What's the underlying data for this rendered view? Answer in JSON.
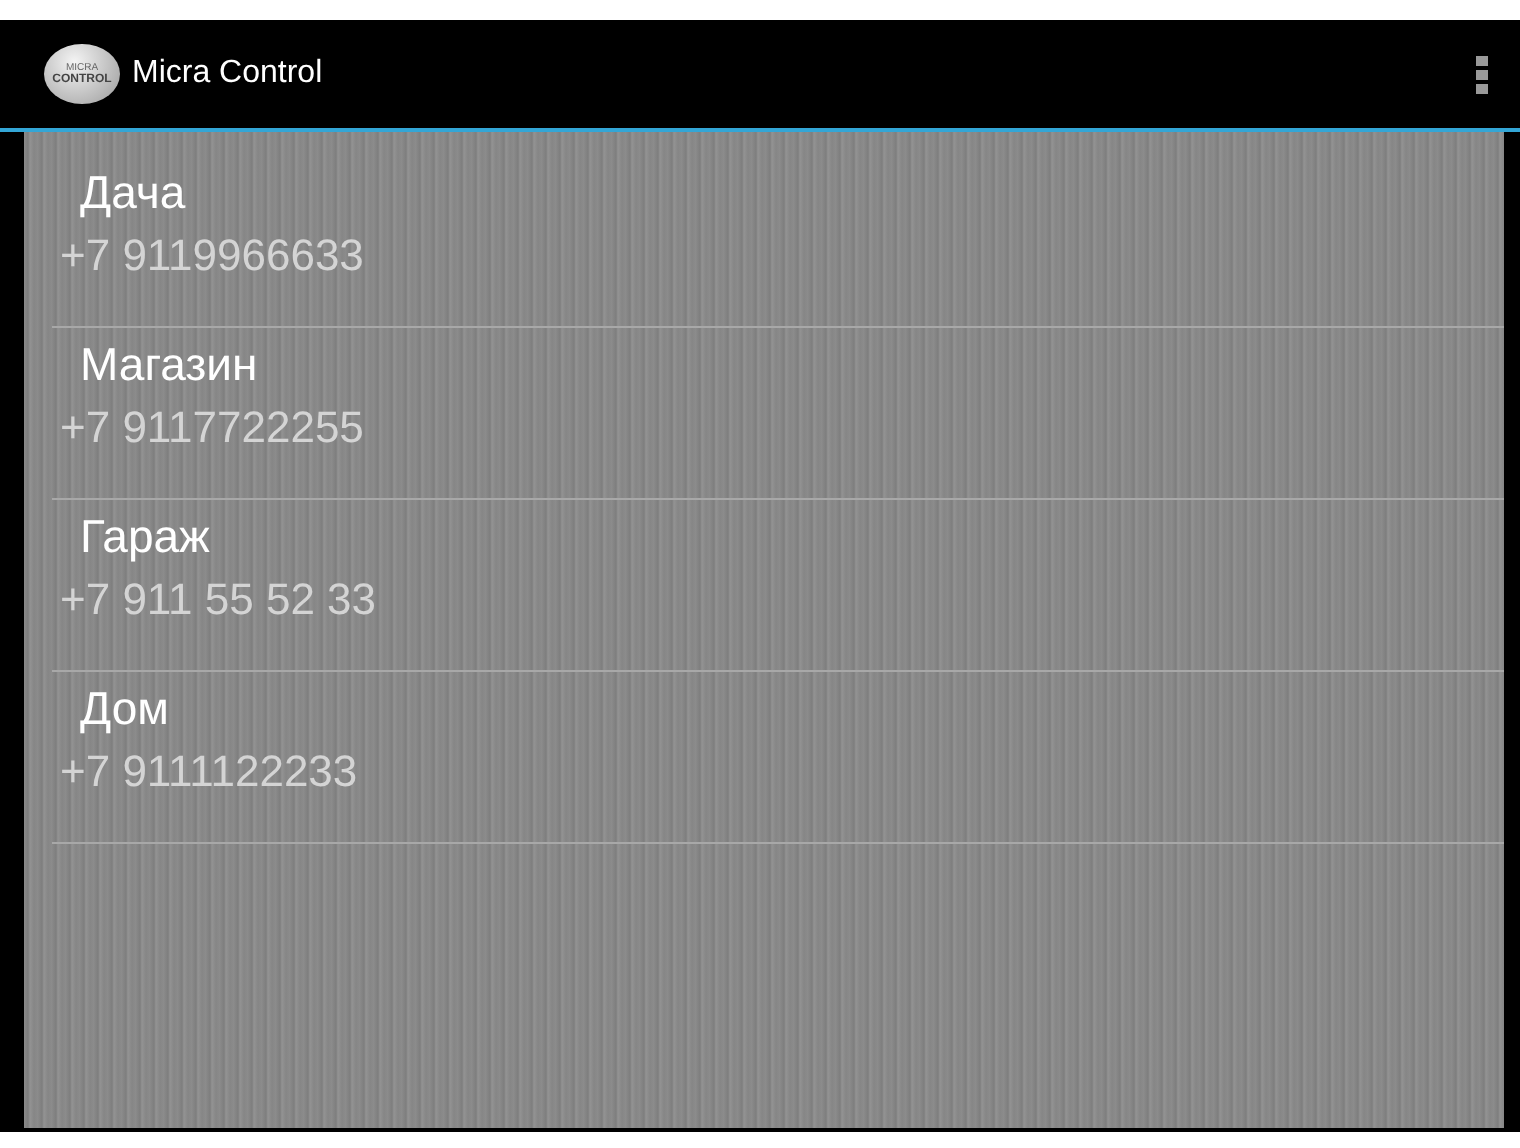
{
  "action_bar": {
    "logo_text": [
      "MICRA",
      "CONTROL"
    ],
    "title": "Micra Control"
  },
  "contacts": [
    {
      "name": "Дача",
      "phone": "+7 9119966633"
    },
    {
      "name": "Магазин",
      "phone": "+7 9117722255"
    },
    {
      "name": "Гараж",
      "phone": "+7 911 55 52 33"
    },
    {
      "name": "Дом",
      "phone": "+7 9111122233"
    }
  ]
}
